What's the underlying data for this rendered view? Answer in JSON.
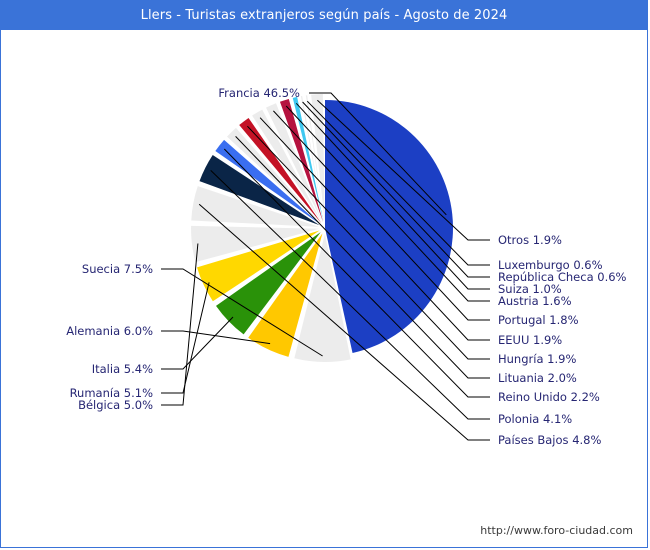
{
  "window": {
    "title": "Llers - Turistas extranjeros según país - Agosto de 2024",
    "title_bar_color": "#3a73d8",
    "border_color": "#3a73d8"
  },
  "footer": {
    "source": "http://www.foro-ciudad.com"
  },
  "labels": {
    "francia": "Francia 46.5%",
    "suecia": "Suecia 7.5%",
    "alemania": "Alemania 6.0%",
    "italia": "Italia 5.4%",
    "rumania": "Rumanía 5.1%",
    "belgica": "Bélgica 5.0%",
    "paises_bajos": "Países Bajos 4.8%",
    "polonia": "Polonia 4.1%",
    "reino_unido": "Reino Unido 2.2%",
    "lituania": "Lituania 2.0%",
    "hungria": "Hungría 1.9%",
    "eeuu": "EEUU 1.9%",
    "portugal": "Portugal 1.8%",
    "austria": "Austria 1.6%",
    "suiza": "Suiza 1.0%",
    "republica_checa": "República Checa 0.6%",
    "luxemburgo": "Luxemburgo 0.6%",
    "otros": "Otros 1.9%"
  },
  "chart_data": {
    "type": "pie",
    "title": "Llers - Turistas extranjeros según país - Agosto de 2024",
    "label_position": "outside-with-leader-lines",
    "legend": "none",
    "grid": false,
    "style": "exploded-fan",
    "unit": "percent",
    "categories": [
      "Francia",
      "Suecia",
      "Alemania",
      "Italia",
      "Rumanía",
      "Bélgica",
      "Países Bajos",
      "Polonia",
      "Reino Unido",
      "Lituania",
      "Hungría",
      "EEUU",
      "Portugal",
      "Austria",
      "Suiza",
      "República Checa",
      "Luxemburgo",
      "Otros"
    ],
    "values": [
      46.5,
      7.5,
      6.0,
      5.4,
      5.1,
      5.0,
      4.8,
      4.1,
      2.2,
      2.0,
      1.9,
      1.9,
      1.8,
      1.6,
      1.0,
      0.6,
      0.6,
      1.9
    ],
    "colors": [
      "#1c3fc4",
      "#ececec",
      "#ffc800",
      "#2a9209",
      "#ffd800",
      "#ececec",
      "#ececec",
      "#0a2547",
      "#3a6ef0",
      "#ececec",
      "#c41225",
      "#ececec",
      "#ececec",
      "#b5123f",
      "#3fc8f0",
      "#ececec",
      "#ececec",
      "#ececec"
    ],
    "slices": [
      {
        "name": "Francia",
        "value": 46.5,
        "label": "Francia 46.5%",
        "color": "#1c3fc4"
      },
      {
        "name": "Suecia",
        "value": 7.5,
        "label": "Suecia 7.5%",
        "color": "#ececec"
      },
      {
        "name": "Alemania",
        "value": 6.0,
        "label": "Alemania 6.0%",
        "color": "#ffc800"
      },
      {
        "name": "Italia",
        "value": 5.4,
        "label": "Italia 5.4%",
        "color": "#2a9209"
      },
      {
        "name": "Rumanía",
        "value": 5.1,
        "label": "Rumanía 5.1%",
        "color": "#ffd800"
      },
      {
        "name": "Bélgica",
        "value": 5.0,
        "label": "Bélgica 5.0%",
        "color": "#ececec"
      },
      {
        "name": "Países Bajos",
        "value": 4.8,
        "label": "Países Bajos 4.8%",
        "color": "#ececec"
      },
      {
        "name": "Polonia",
        "value": 4.1,
        "label": "Polonia 4.1%",
        "color": "#0a2547"
      },
      {
        "name": "Reino Unido",
        "value": 2.2,
        "label": "Reino Unido 2.2%",
        "color": "#3a6ef0"
      },
      {
        "name": "Lituania",
        "value": 2.0,
        "label": "Lituania 2.0%",
        "color": "#ececec"
      },
      {
        "name": "Hungría",
        "value": 1.9,
        "label": "Hungría 1.9%",
        "color": "#c41225"
      },
      {
        "name": "EEUU",
        "value": 1.9,
        "label": "EEUU 1.9%",
        "color": "#ececec"
      },
      {
        "name": "Portugal",
        "value": 1.8,
        "label": "Portugal 1.8%",
        "color": "#ececec"
      },
      {
        "name": "Austria",
        "value": 1.6,
        "label": "Austria 1.6%",
        "color": "#b5123f"
      },
      {
        "name": "Suiza",
        "value": 1.0,
        "label": "Suiza 1.0%",
        "color": "#3fc8f0"
      },
      {
        "name": "República Checa",
        "value": 0.6,
        "label": "República Checa 0.6%",
        "color": "#ececec"
      },
      {
        "name": "Luxemburgo",
        "value": 0.6,
        "label": "Luxemburgo 0.6%",
        "color": "#ececec"
      },
      {
        "name": "Otros",
        "value": 1.9,
        "label": "Otros 1.9%",
        "color": "#ececec"
      }
    ]
  }
}
